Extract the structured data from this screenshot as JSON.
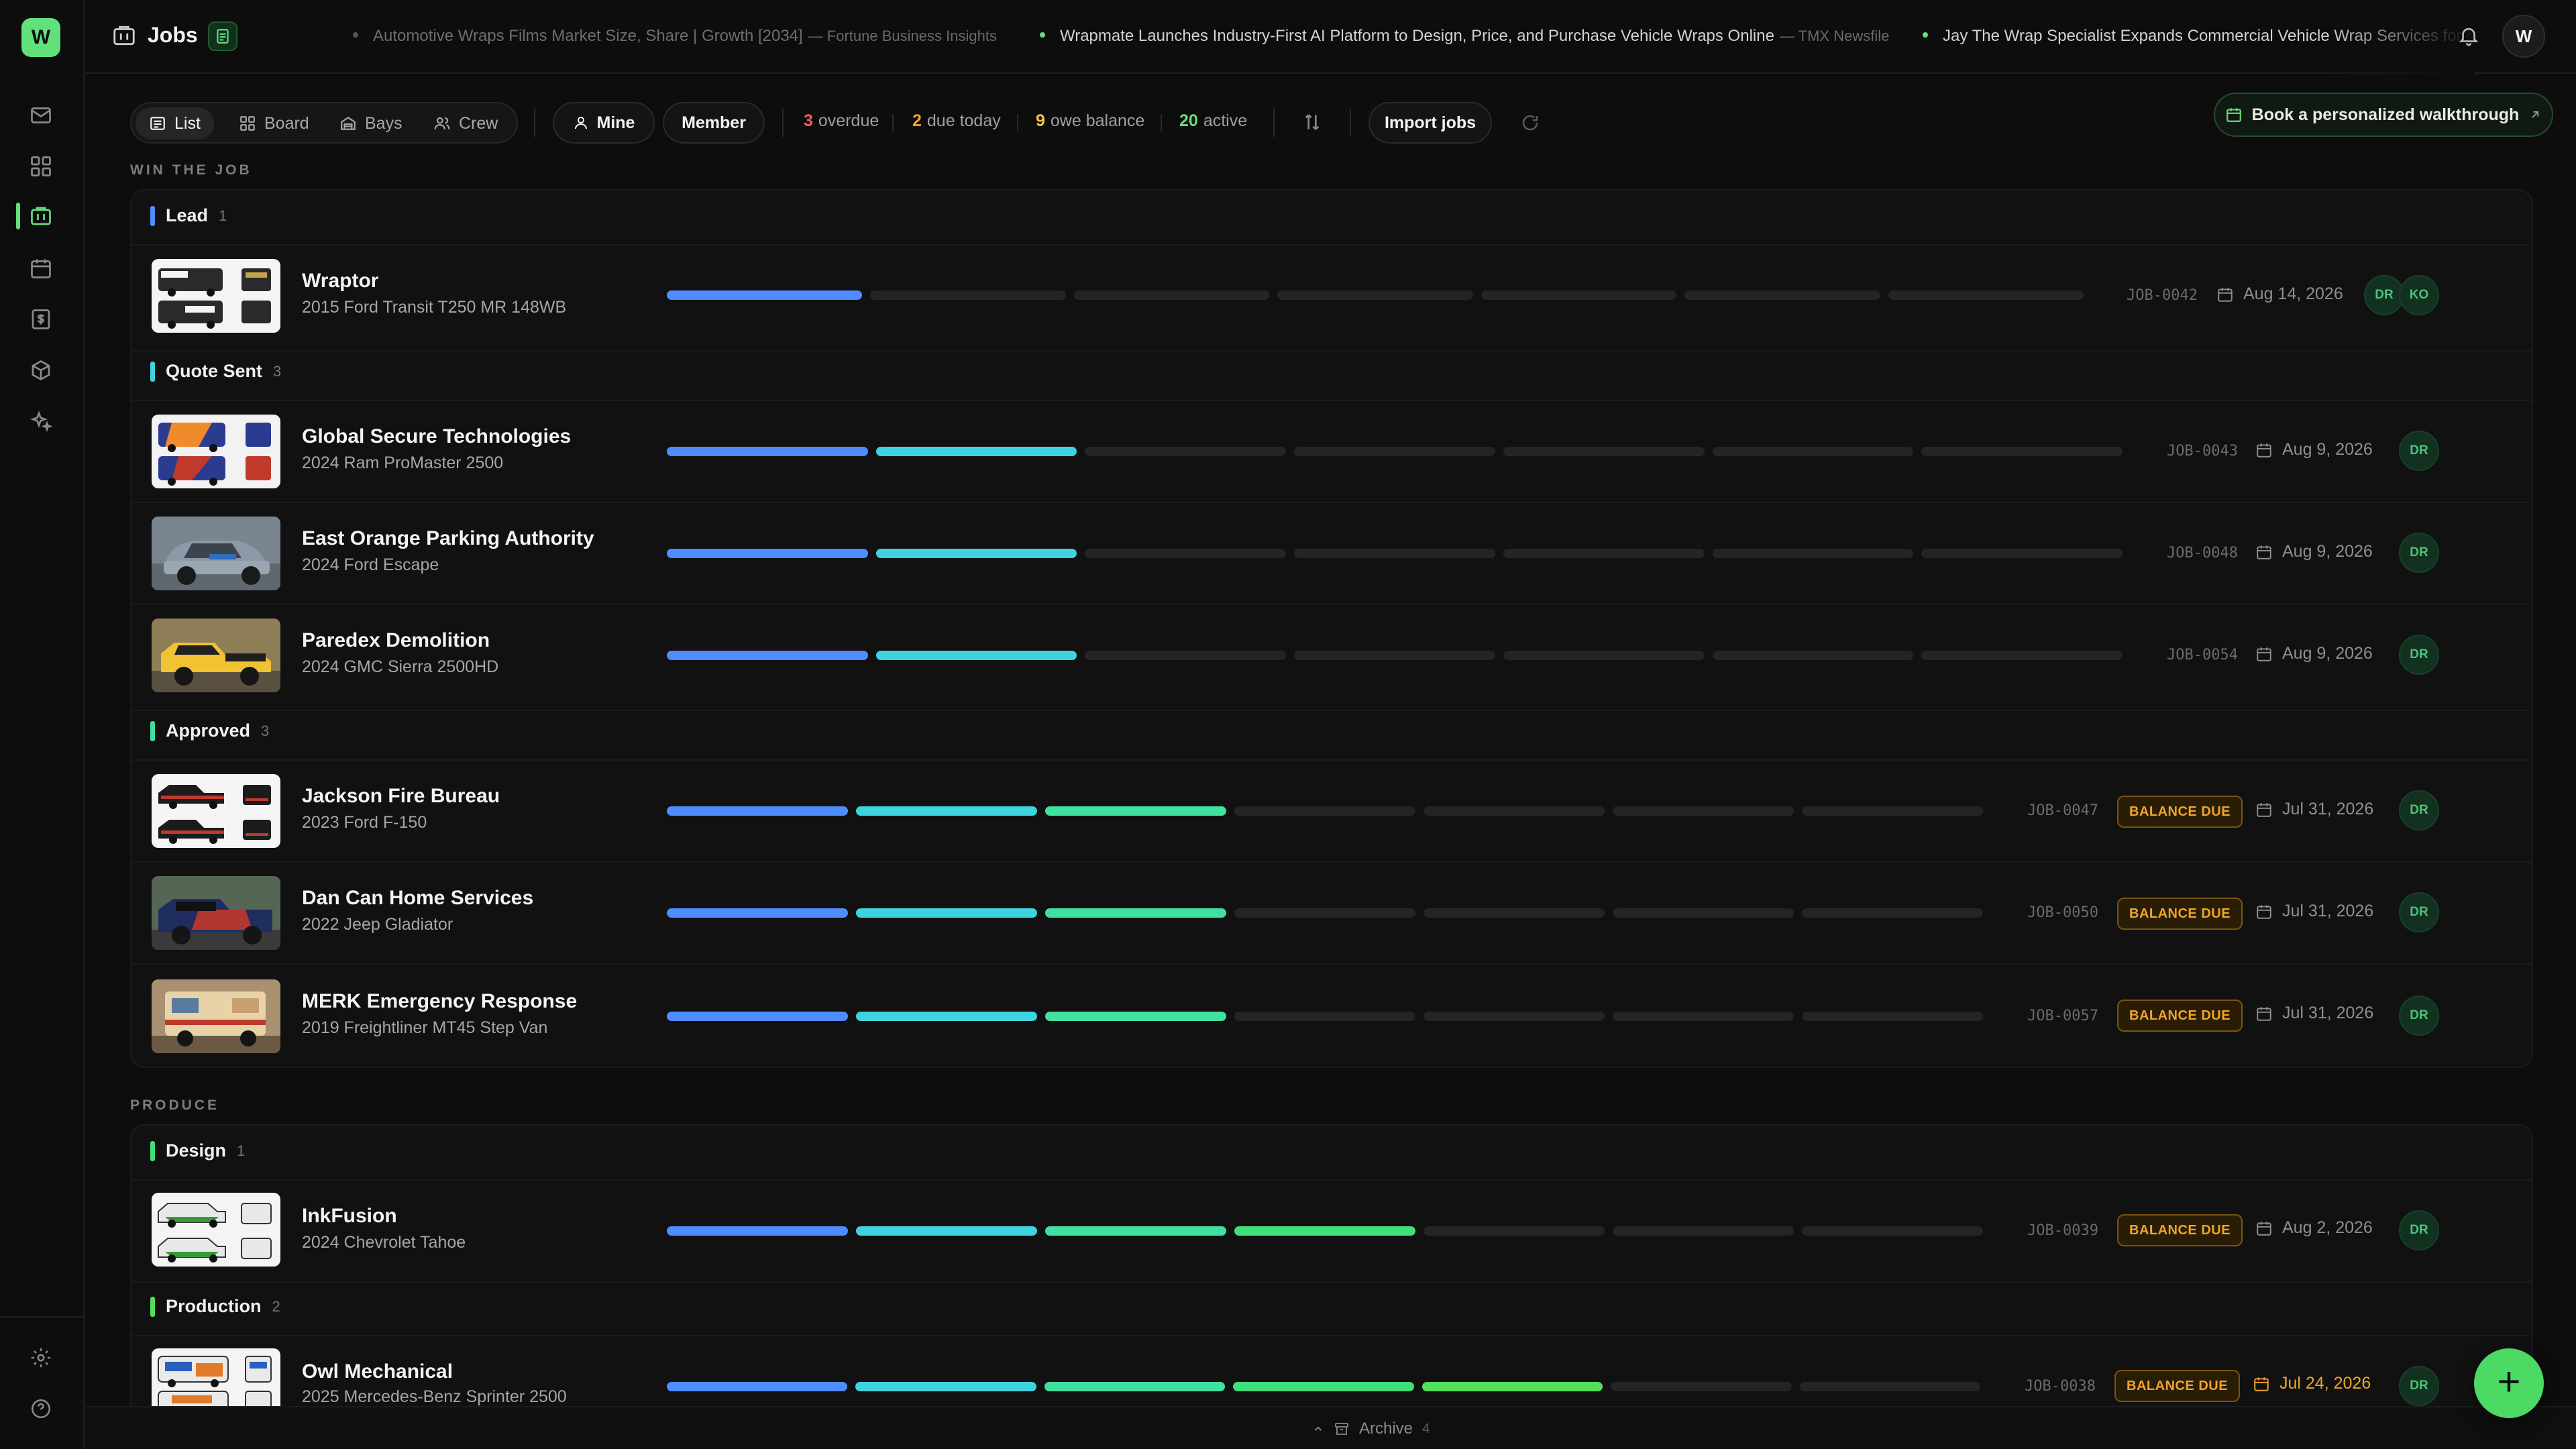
{
  "app": {
    "logo_letter": "W",
    "page_title": "Jobs",
    "user_initial": "W"
  },
  "ticker": [
    {
      "headline": "Automotive Wraps Films Market Size, Share | Growth [2034]",
      "source": "— Fortune Business Insights"
    },
    {
      "headline": "Wrapmate Launches Industry-First AI Platform to Design, Price, and Purchase Vehicle Wraps Online",
      "source": "— TMX Newsfile"
    },
    {
      "headline": "Jay The Wrap Specialist Expands Commercial Vehicle Wrap Services for Mobile",
      "source": ""
    }
  ],
  "views": [
    "List",
    "Board",
    "Bays",
    "Crew"
  ],
  "filters": {
    "mine": "Mine",
    "member": "Member"
  },
  "stats": [
    {
      "value": "3",
      "label": "overdue",
      "color": "#ff5c5c"
    },
    {
      "value": "2",
      "label": "due today",
      "color": "#f0a42a"
    },
    {
      "value": "9",
      "label": "owe balance",
      "color": "#f5c542"
    },
    {
      "value": "20",
      "label": "active",
      "color": "#62e07a"
    }
  ],
  "import_label": "Import jobs",
  "cta_label": "Book a personalized walkthrough",
  "sections": [
    "WIN THE JOB",
    "PRODUCE"
  ],
  "stages": [
    {
      "name": "Lead",
      "count": "1",
      "color": "#4f8cff"
    },
    {
      "name": "Quote Sent",
      "count": "3",
      "color": "#3fd3e0"
    },
    {
      "name": "Approved",
      "count": "3",
      "color": "#40e0a0"
    },
    {
      "name": "Design",
      "count": "1",
      "color": "#3fe07a"
    },
    {
      "name": "Production",
      "count": "2",
      "color": "#52e05a"
    }
  ],
  "balance_label": "BALANCE DUE",
  "jobs": [
    {
      "name": "Wraptor",
      "vehicle": "2015 Ford Transit T250 MR 148WB",
      "id": "JOB-0042",
      "due": "Aug 14, 2026",
      "crew": [
        "DR",
        "KO"
      ]
    },
    {
      "name": "Global Secure Technologies",
      "vehicle": "2024 Ram ProMaster 2500",
      "id": "JOB-0043",
      "due": "Aug 9, 2026",
      "crew": [
        "DR"
      ]
    },
    {
      "name": "East Orange Parking Authority",
      "vehicle": "2024 Ford Escape",
      "id": "JOB-0048",
      "due": "Aug 9, 2026",
      "crew": [
        "DR"
      ]
    },
    {
      "name": "Paredex Demolition",
      "vehicle": "2024 GMC Sierra 2500HD",
      "id": "JOB-0054",
      "due": "Aug 9, 2026",
      "crew": [
        "DR"
      ]
    },
    {
      "name": "Jackson Fire Bureau",
      "vehicle": "2023 Ford F-150",
      "id": "JOB-0047",
      "due": "Jul 31, 2026",
      "crew": [
        "DR"
      ]
    },
    {
      "name": "Dan Can Home Services",
      "vehicle": "2022 Jeep Gladiator",
      "id": "JOB-0050",
      "due": "Jul 31, 2026",
      "crew": [
        "DR"
      ]
    },
    {
      "name": "MERK Emergency Response",
      "vehicle": "2019 Freightliner MT45 Step Van",
      "id": "JOB-0057",
      "due": "Jul 31, 2026",
      "crew": [
        "DR"
      ]
    },
    {
      "name": "InkFusion",
      "vehicle": "2024 Chevrolet Tahoe",
      "id": "JOB-0039",
      "due": "Aug 2, 2026",
      "crew": [
        "DR"
      ]
    },
    {
      "name": "Owl Mechanical",
      "vehicle": "2025 Mercedes-Benz Sprinter 2500",
      "id": "JOB-0038",
      "due": "Jul 24, 2026",
      "crew": [
        "DR"
      ]
    }
  ],
  "archive": {
    "label": "Archive",
    "count": "4"
  },
  "fab_label": "+"
}
